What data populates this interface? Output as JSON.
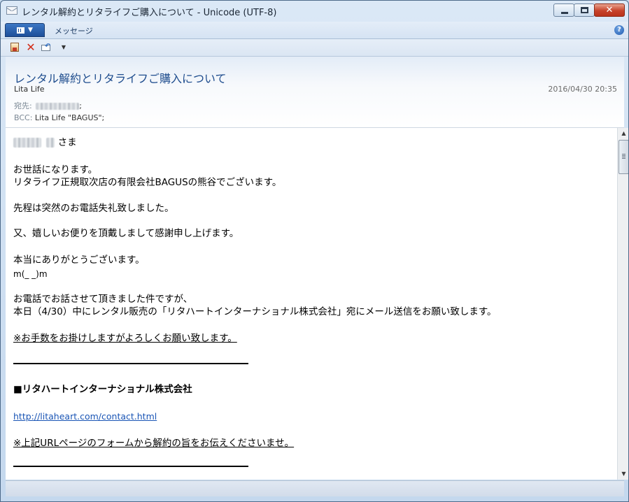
{
  "window": {
    "title": "レンタル解約とリタライフご購入について - Unicode (UTF-8)",
    "minimize_glyph": "",
    "close_glyph": "✕"
  },
  "ribbon": {
    "tab_message": "メッセージ",
    "help_glyph": "?"
  },
  "quick_access": {
    "delete_glyph": "✕",
    "more_glyph": "▼"
  },
  "header": {
    "subject": "レンタル解約とリタライフご購入について",
    "from": "Lita Life",
    "date": "2016/04/30 20:35",
    "to_label": "宛先:",
    "to_suffix": ";",
    "bcc_label": "BCC:",
    "bcc_value": "Lita Life \"BAGUS\";"
  },
  "body": {
    "greeting_suffix": "さま",
    "line1": "お世話になります。",
    "line2": "リタライフ正規取次店の有限会社BAGUSの熊谷でございます。",
    "line3": "先程は突然のお電話失礼致しました。",
    "line4": "又、嬉しいお便りを頂戴しまして感謝申し上げます。",
    "line5": "本当にありがとうございます。",
    "line6": "m(_ _)m",
    "line7": "お電話でお話させて頂きました件ですが、",
    "line8": "本日（4/30）中にレンタル販売の「リタハートインターナショナル株式会社」宛にメール送信をお願い致します。",
    "line9": "※お手数をお掛けしますがよろしくお願い致します。",
    "company": "■リタハートインターナショナル株式会社",
    "url": "http://litaheart.com/contact.html",
    "note": "※上記URLページのフォームから解約の旨をお伝えくださいませ。"
  },
  "scrollbar": {
    "up_glyph": "▲",
    "down_glyph": "▼"
  }
}
